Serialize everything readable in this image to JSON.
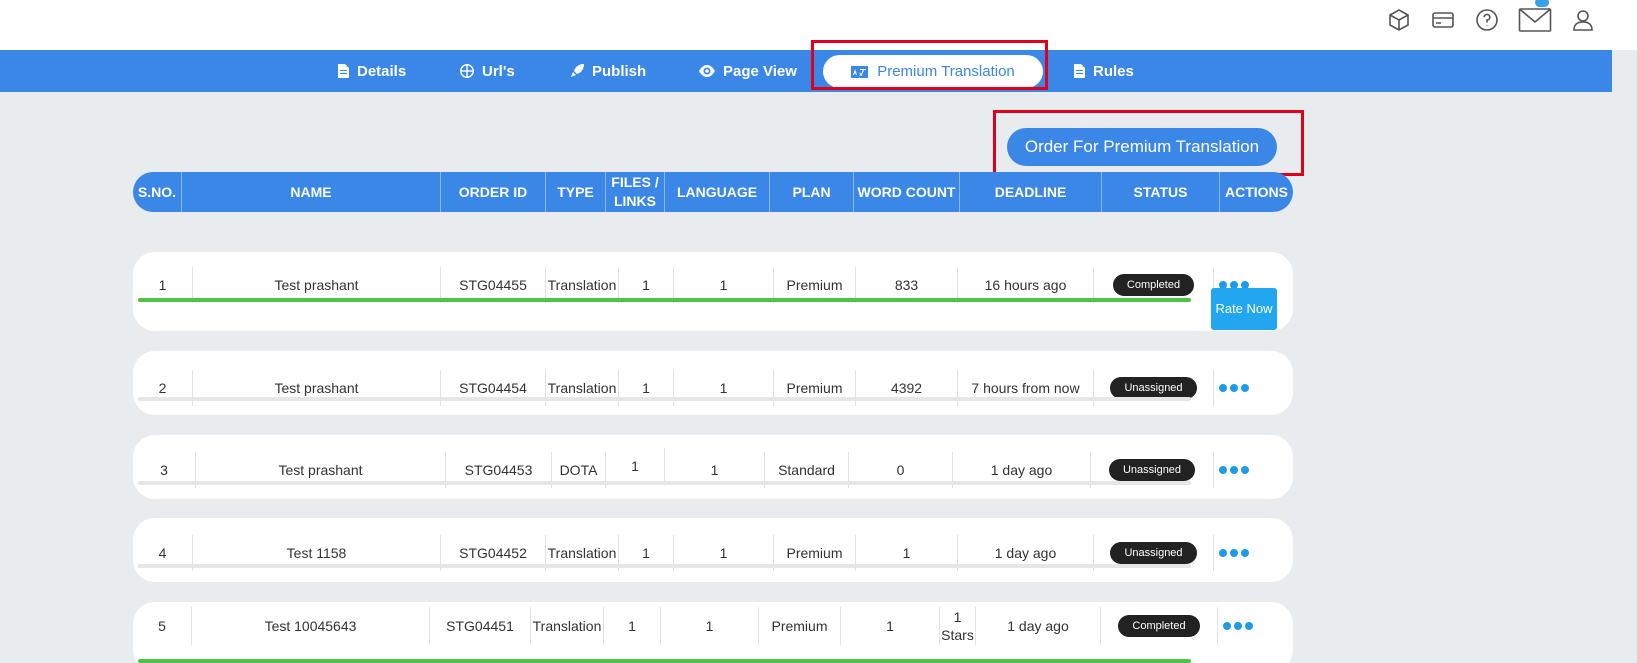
{
  "tabs": [
    {
      "label": "Details",
      "icon": "file-icon"
    },
    {
      "label": "Url's",
      "icon": "globe-icon"
    },
    {
      "label": "Publish",
      "icon": "rocket-icon"
    },
    {
      "label": "Page View",
      "icon": "eye-icon"
    },
    {
      "label": "Premium Translation",
      "icon": "translate-icon"
    },
    {
      "label": "Rules",
      "icon": "file-icon"
    }
  ],
  "order_button": "Order For Premium Translation",
  "headers": {
    "sno": "S.NO.",
    "name": "NAME",
    "order_id": "ORDER ID",
    "type": "TYPE",
    "files_1": "FILES /",
    "files_2": "LINKS",
    "language": "LANGUAGE",
    "plan": "PLAN",
    "word_count": "WORD COUNT",
    "deadline": "DEADLINE",
    "status": "STATUS",
    "actions": "ACTIONS"
  },
  "rows": [
    {
      "sno": "1",
      "name": "Test prashant",
      "order_id": "STG04455",
      "type": "Translation",
      "files": "1",
      "language": "1",
      "plan": "Premium",
      "word_count": "833",
      "deadline": "16 hours ago",
      "status": "Completed",
      "progress": 1.0,
      "rate_label": "Rate Now"
    },
    {
      "sno": "2",
      "name": "Test prashant",
      "order_id": "STG04454",
      "type": "Translation",
      "files": "1",
      "language": "1",
      "plan": "Premium",
      "word_count": "4392",
      "deadline": "7 hours from now",
      "status": "Unassigned",
      "progress": 0
    },
    {
      "sno": "3",
      "name": "Test prashant",
      "order_id": "STG04453",
      "type": "DOTA",
      "files": "1",
      "language": "1",
      "plan": "Standard",
      "word_count": "0",
      "deadline": "1 day ago",
      "status": "Unassigned",
      "progress": 0
    },
    {
      "sno": "4",
      "name": "Test 1158",
      "order_id": "STG04452",
      "type": "Translation",
      "files": "1",
      "language": "1",
      "plan": "Premium",
      "word_count": "1",
      "deadline": "1 day ago",
      "status": "Unassigned",
      "progress": 0
    },
    {
      "sno": "5",
      "name": "Test 10045643",
      "order_id": "STG04451",
      "type": "Translation",
      "files": "1",
      "language": "1",
      "plan": "Premium",
      "word_count": "1",
      "rating_1": "1",
      "rating_2": "Stars",
      "deadline": "1 day ago",
      "status": "Completed",
      "progress": 1.0
    }
  ]
}
